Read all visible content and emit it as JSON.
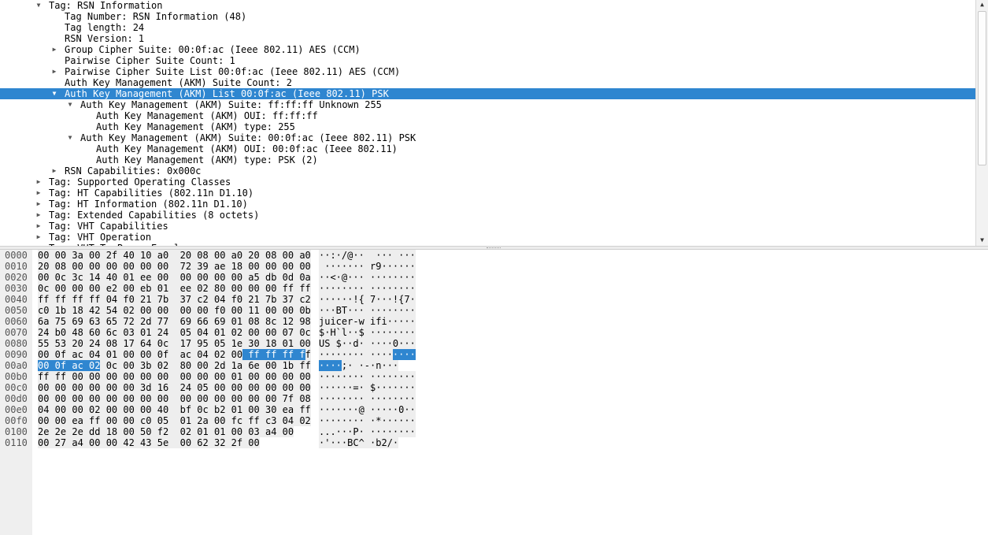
{
  "packet_details": {
    "rows": [
      {
        "text": "Tag: RSN Information",
        "level": 0,
        "expander": "expanded",
        "selected": false
      },
      {
        "text": "Tag Number: RSN Information (48)",
        "level": 1,
        "expander": "none",
        "selected": false
      },
      {
        "text": "Tag length: 24",
        "level": 1,
        "expander": "none",
        "selected": false
      },
      {
        "text": "RSN Version: 1",
        "level": 1,
        "expander": "none",
        "selected": false
      },
      {
        "text": "Group Cipher Suite: 00:0f:ac (Ieee 802.11) AES (CCM)",
        "level": 1,
        "expander": "collapsed",
        "selected": false
      },
      {
        "text": "Pairwise Cipher Suite Count: 1",
        "level": 1,
        "expander": "none",
        "selected": false
      },
      {
        "text": "Pairwise Cipher Suite List 00:0f:ac (Ieee 802.11) AES (CCM)",
        "level": 1,
        "expander": "collapsed",
        "selected": false
      },
      {
        "text": "Auth Key Management (AKM) Suite Count: 2",
        "level": 1,
        "expander": "none",
        "selected": false
      },
      {
        "text": "Auth Key Management (AKM) List 00:0f:ac (Ieee 802.11) PSK",
        "level": 1,
        "expander": "expanded",
        "selected": true
      },
      {
        "text": "Auth Key Management (AKM) Suite: ff:ff:ff Unknown 255",
        "level": 2,
        "expander": "expanded",
        "selected": false
      },
      {
        "text": "Auth Key Management (AKM) OUI: ff:ff:ff",
        "level": 3,
        "expander": "none",
        "selected": false
      },
      {
        "text": "Auth Key Management (AKM) type: 255",
        "level": 3,
        "expander": "none",
        "selected": false
      },
      {
        "text": "Auth Key Management (AKM) Suite: 00:0f:ac (Ieee 802.11) PSK",
        "level": 2,
        "expander": "expanded",
        "selected": false
      },
      {
        "text": "Auth Key Management (AKM) OUI: 00:0f:ac (Ieee 802.11)",
        "level": 3,
        "expander": "none",
        "selected": false
      },
      {
        "text": "Auth Key Management (AKM) type: PSK (2)",
        "level": 3,
        "expander": "none",
        "selected": false
      },
      {
        "text": "RSN Capabilities: 0x000c",
        "level": 1,
        "expander": "collapsed",
        "selected": false
      },
      {
        "text": "Tag: Supported Operating Classes",
        "level": 0,
        "expander": "collapsed",
        "selected": false
      },
      {
        "text": "Tag: HT Capabilities (802.11n D1.10)",
        "level": 0,
        "expander": "collapsed",
        "selected": false
      },
      {
        "text": "Tag: HT Information (802.11n D1.10)",
        "level": 0,
        "expander": "collapsed",
        "selected": false
      },
      {
        "text": "Tag: Extended Capabilities (8 octets)",
        "level": 0,
        "expander": "collapsed",
        "selected": false
      },
      {
        "text": "Tag: VHT Capabilities",
        "level": 0,
        "expander": "collapsed",
        "selected": false
      },
      {
        "text": "Tag: VHT Operation",
        "level": 0,
        "expander": "collapsed",
        "selected": false
      },
      {
        "text": "Tag: VHT Tx Power Envelope",
        "level": 0,
        "expander": "collapsed",
        "selected": false
      }
    ]
  },
  "packet_bytes": {
    "rows": [
      {
        "offset": "0000",
        "hex": "00 00 3a 00 2f 40 10 a0  20 08 00 a0 20 08 00 a0",
        "ascii": "··:·/@··  ··· ···"
      },
      {
        "offset": "0010",
        "hex": "20 08 00 00 00 00 00 00  72 39 ae 18 00 00 00 00",
        "ascii": " ······· r9······"
      },
      {
        "offset": "0020",
        "hex": "00 0c 3c 14 40 01 ee 00  00 00 00 00 a5 db 0d 0a",
        "ascii": "··<·@··· ········"
      },
      {
        "offset": "0030",
        "hex": "0c 00 00 00 e2 00 eb 01  ee 02 80 00 00 00 ff ff",
        "ascii": "········ ········"
      },
      {
        "offset": "0040",
        "hex": "ff ff ff ff 04 f0 21 7b  37 c2 04 f0 21 7b 37 c2",
        "ascii": "······!{ 7···!{7·"
      },
      {
        "offset": "0050",
        "hex": "c0 1b 18 42 54 02 00 00  00 00 f0 00 11 00 00 0b",
        "ascii": "···BT··· ········"
      },
      {
        "offset": "0060",
        "hex": "6a 75 69 63 65 72 2d 77  69 66 69 01 08 8c 12 98",
        "ascii": "juicer-w ifi·····"
      },
      {
        "offset": "0070",
        "hex": "24 b0 48 60 6c 03 01 24  05 04 01 02 00 00 07 0c",
        "ascii": "$·H`l··$ ········"
      },
      {
        "offset": "0080",
        "hex": "55 53 20 24 08 17 64 0c  17 95 05 1e 30 18 01 00",
        "ascii": "US $··d· ····0···"
      },
      {
        "offset": "0090",
        "hex": "00 0f ac 04 01 00 00 0f  ac 04 02 00 ff ff ff ff",
        "ascii": "········ ········",
        "hl_hex": [
          36,
          47
        ],
        "hl_ascii": [
          13,
          17
        ]
      },
      {
        "offset": "00a0",
        "hex": "00 0f ac 02 0c 00 3b 02  80 00 2d 1a 6e 00 1b ff",
        "ascii": "····;· ·-·n···",
        "hl_hex": [
          0,
          11
        ],
        "hl_ascii": [
          0,
          4
        ]
      },
      {
        "offset": "00b0",
        "hex": "ff ff 00 00 00 00 00 00  00 00 00 01 00 00 00 00",
        "ascii": "········ ········"
      },
      {
        "offset": "00c0",
        "hex": "00 00 00 00 00 00 3d 16  24 05 00 00 00 00 00 00",
        "ascii": "······=· $·······"
      },
      {
        "offset": "00d0",
        "hex": "00 00 00 00 00 00 00 00  00 00 00 00 00 00 7f 08",
        "ascii": "········ ········"
      },
      {
        "offset": "00e0",
        "hex": "04 00 00 02 00 00 00 40  bf 0c b2 01 00 30 ea ff",
        "ascii": "·······@ ·····0··"
      },
      {
        "offset": "00f0",
        "hex": "00 00 ea ff 00 00 c0 05  01 2a 00 fc ff c3 04 02",
        "ascii": "········ ·*······"
      },
      {
        "offset": "0100",
        "hex": "2e 2e 2e dd 18 00 50 f2  02 01 01 00 03 a4 00",
        "ascii": "...···P· ········"
      },
      {
        "offset": "0110",
        "hex": "00 27 a4 00 00 42 43 5e  00 62 32 2f 00",
        "ascii": "·'···BC^ ·b2/·"
      }
    ]
  },
  "icons": {
    "expanded": "triangle-down-icon",
    "collapsed": "triangle-right-icon",
    "scroll_up": "scroll-up-arrow-icon",
    "scroll_down": "scroll-down-arrow-icon"
  },
  "colors": {
    "selection": "#2f86d0",
    "bytes_background": "#eeeeee",
    "gutter_background": "#efefef"
  }
}
